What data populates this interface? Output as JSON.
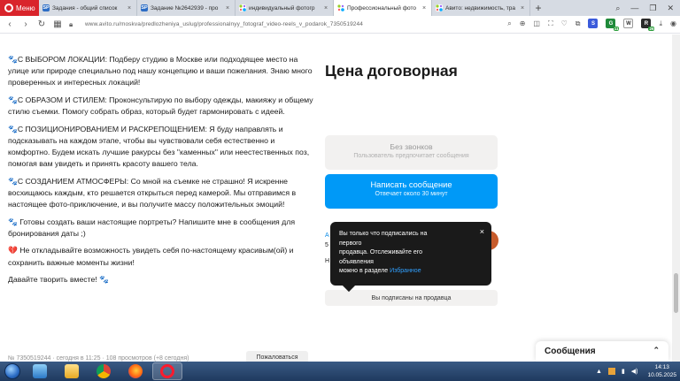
{
  "browser": {
    "menu_label": "Меню",
    "tabs": [
      {
        "title": "Задания - общий список",
        "favicon": "SP",
        "active": false
      },
      {
        "title": "Задание №2642939 - про",
        "favicon": "SP",
        "active": false
      },
      {
        "title": "индивидуальный фотогр",
        "favicon": "avito-icon",
        "active": false
      },
      {
        "title": "Профессиональный фото",
        "favicon": "avito-icon",
        "active": true
      },
      {
        "title": "Авито: недвижимость, тра",
        "favicon": "avito-icon",
        "active": false
      }
    ],
    "new_tab": "+",
    "url": "www.avito.ru/moskva/predlozheniya_uslug/professionalnyy_fotograf_video-reels_v_podarok_7350519244",
    "extension_badges": {
      "ext1": "11",
      "ext2": "26"
    }
  },
  "listing": {
    "description": [
      "🐾С ВЫБОРОМ ЛОКАЦИИ: Подберу студию в Москве или подходящее место на улице или природе специально под нашу концепцию и ваши пожелания. Знаю много проверенных и интересных локаций!",
      "🐾С ОБРАЗОМ И СТИЛЕМ: Проконсультирую по выбору одежды, макияжу и общему стилю съемки. Помогу собрать образ, который будет гармонировать с идеей.",
      "🐾С ПОЗИЦИОНИРОВАНИЕМ И РАСКРЕПОЩЕНИЕМ: Я буду направлять и подсказывать на каждом этапе, чтобы вы чувствовали себя естественно и комфортно. Будем искать лучшие ракурсы без \"каменных\" или неестественных поз, помогая вам увидеть и принять красоту вашего тела.",
      "🐾С СОЗДАНИЕМ АТМОСФЕРЫ: Со мной на съемке не страшно! Я искренне восхищаюсь каждым, кто решается открыться перед камерой. Мы отправимся в настоящее фото-приключение, и вы получите массу положительных эмоций!",
      "🐾 Готовы создать ваши настоящие портреты? Напишите мне в сообщения для бронирования даты ;)",
      "💔 Не откладывайте возможность увидеть себя по-настоящему красивым(ой) и сохранить важные моменты жизни!",
      "Давайте творить вместе! 🐾"
    ],
    "meta": "№ 7350519244 · сегодня в 11:25 · 108 просмотров (+8 сегодня)",
    "complain_label": "Пожаловаться"
  },
  "sidebar": {
    "price": "Цена договорная",
    "no_calls": {
      "title": "Без звонков",
      "subtitle": "Пользователь предпочитает сообщения"
    },
    "write": {
      "title": "Написать сообщение",
      "subtitle": "Отвечает около 30 минут"
    },
    "subscribed_label": "Вы подписаны на продавца",
    "seller_peek": {
      "a": "А",
      "b": "5",
      "c": "Н"
    }
  },
  "tooltip": {
    "line1": "Вы только что подписались на",
    "line2": "первого",
    "line3": "продавца. Отслеживайте его",
    "line4": "объявления",
    "line5_prefix": "можно в разделе ",
    "line5_link": "Избранное",
    "close": "×"
  },
  "messages_panel": {
    "title": "Сообщения"
  },
  "taskbar": {
    "time": "14:13",
    "date": "10.05.2025",
    "apps": [
      "explorer-icon",
      "folder-icon",
      "chrome-icon",
      "firefox-icon",
      "opera-icon"
    ]
  },
  "colors": {
    "opera_red": "#d9242b",
    "avito_blue": "#0099f7",
    "tooltip_bg": "#1a1a1a",
    "link_blue": "#31a0ff"
  }
}
